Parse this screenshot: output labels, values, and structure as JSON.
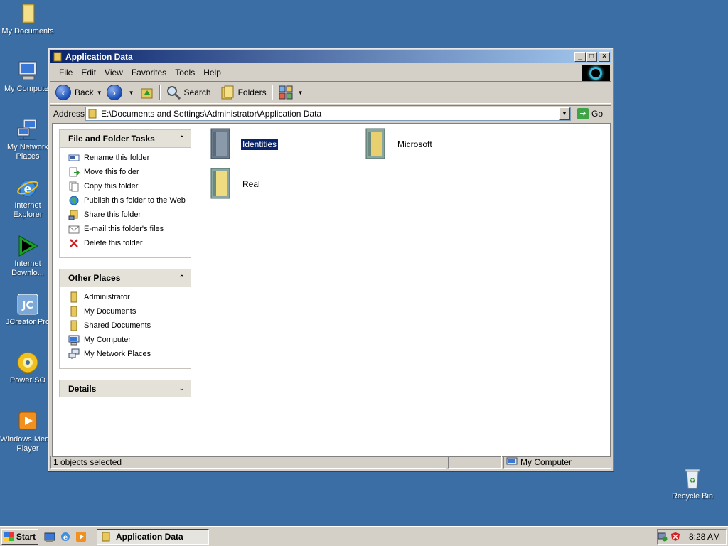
{
  "desktop": {
    "icons": [
      {
        "label": "My Documents"
      },
      {
        "label": "My Computer"
      },
      {
        "label": "My Network\nPlaces"
      },
      {
        "label": "Internet\nExplorer"
      },
      {
        "label": "Internet\nDownlo..."
      },
      {
        "label": "JCreator Pro"
      },
      {
        "label": "PowerISO"
      },
      {
        "label": "Windows Media\nPlayer"
      },
      {
        "label": "Recycle Bin"
      }
    ]
  },
  "window": {
    "title": "Application Data",
    "menu": [
      "File",
      "Edit",
      "View",
      "Favorites",
      "Tools",
      "Help"
    ],
    "toolbar": {
      "back": "Back",
      "search": "Search",
      "folders": "Folders"
    },
    "address": {
      "label": "Address",
      "value": "E:\\Documents and Settings\\Administrator\\Application Data",
      "go": "Go"
    },
    "file_tasks": {
      "title": "File and Folder Tasks",
      "items": [
        {
          "label": "Rename this folder"
        },
        {
          "label": "Move this folder"
        },
        {
          "label": "Copy this folder"
        },
        {
          "label": "Publish this folder to the Web"
        },
        {
          "label": "Share this folder"
        },
        {
          "label": "E-mail this folder's files"
        },
        {
          "label": "Delete this folder"
        }
      ]
    },
    "other_places": {
      "title": "Other Places",
      "items": [
        {
          "label": "Administrator"
        },
        {
          "label": "My Documents"
        },
        {
          "label": "Shared Documents"
        },
        {
          "label": "My Computer"
        },
        {
          "label": "My Network Places"
        }
      ]
    },
    "details": {
      "title": "Details"
    },
    "files": [
      {
        "name": "Identities",
        "selected": true
      },
      {
        "name": "Microsoft",
        "selected": false
      },
      {
        "name": "Real",
        "selected": false
      }
    ],
    "status": {
      "left": "1 objects selected",
      "middle": "",
      "right": "My Computer"
    }
  },
  "taskbar": {
    "start": "Start",
    "task": "Application Data",
    "clock": "8:28 AM"
  }
}
